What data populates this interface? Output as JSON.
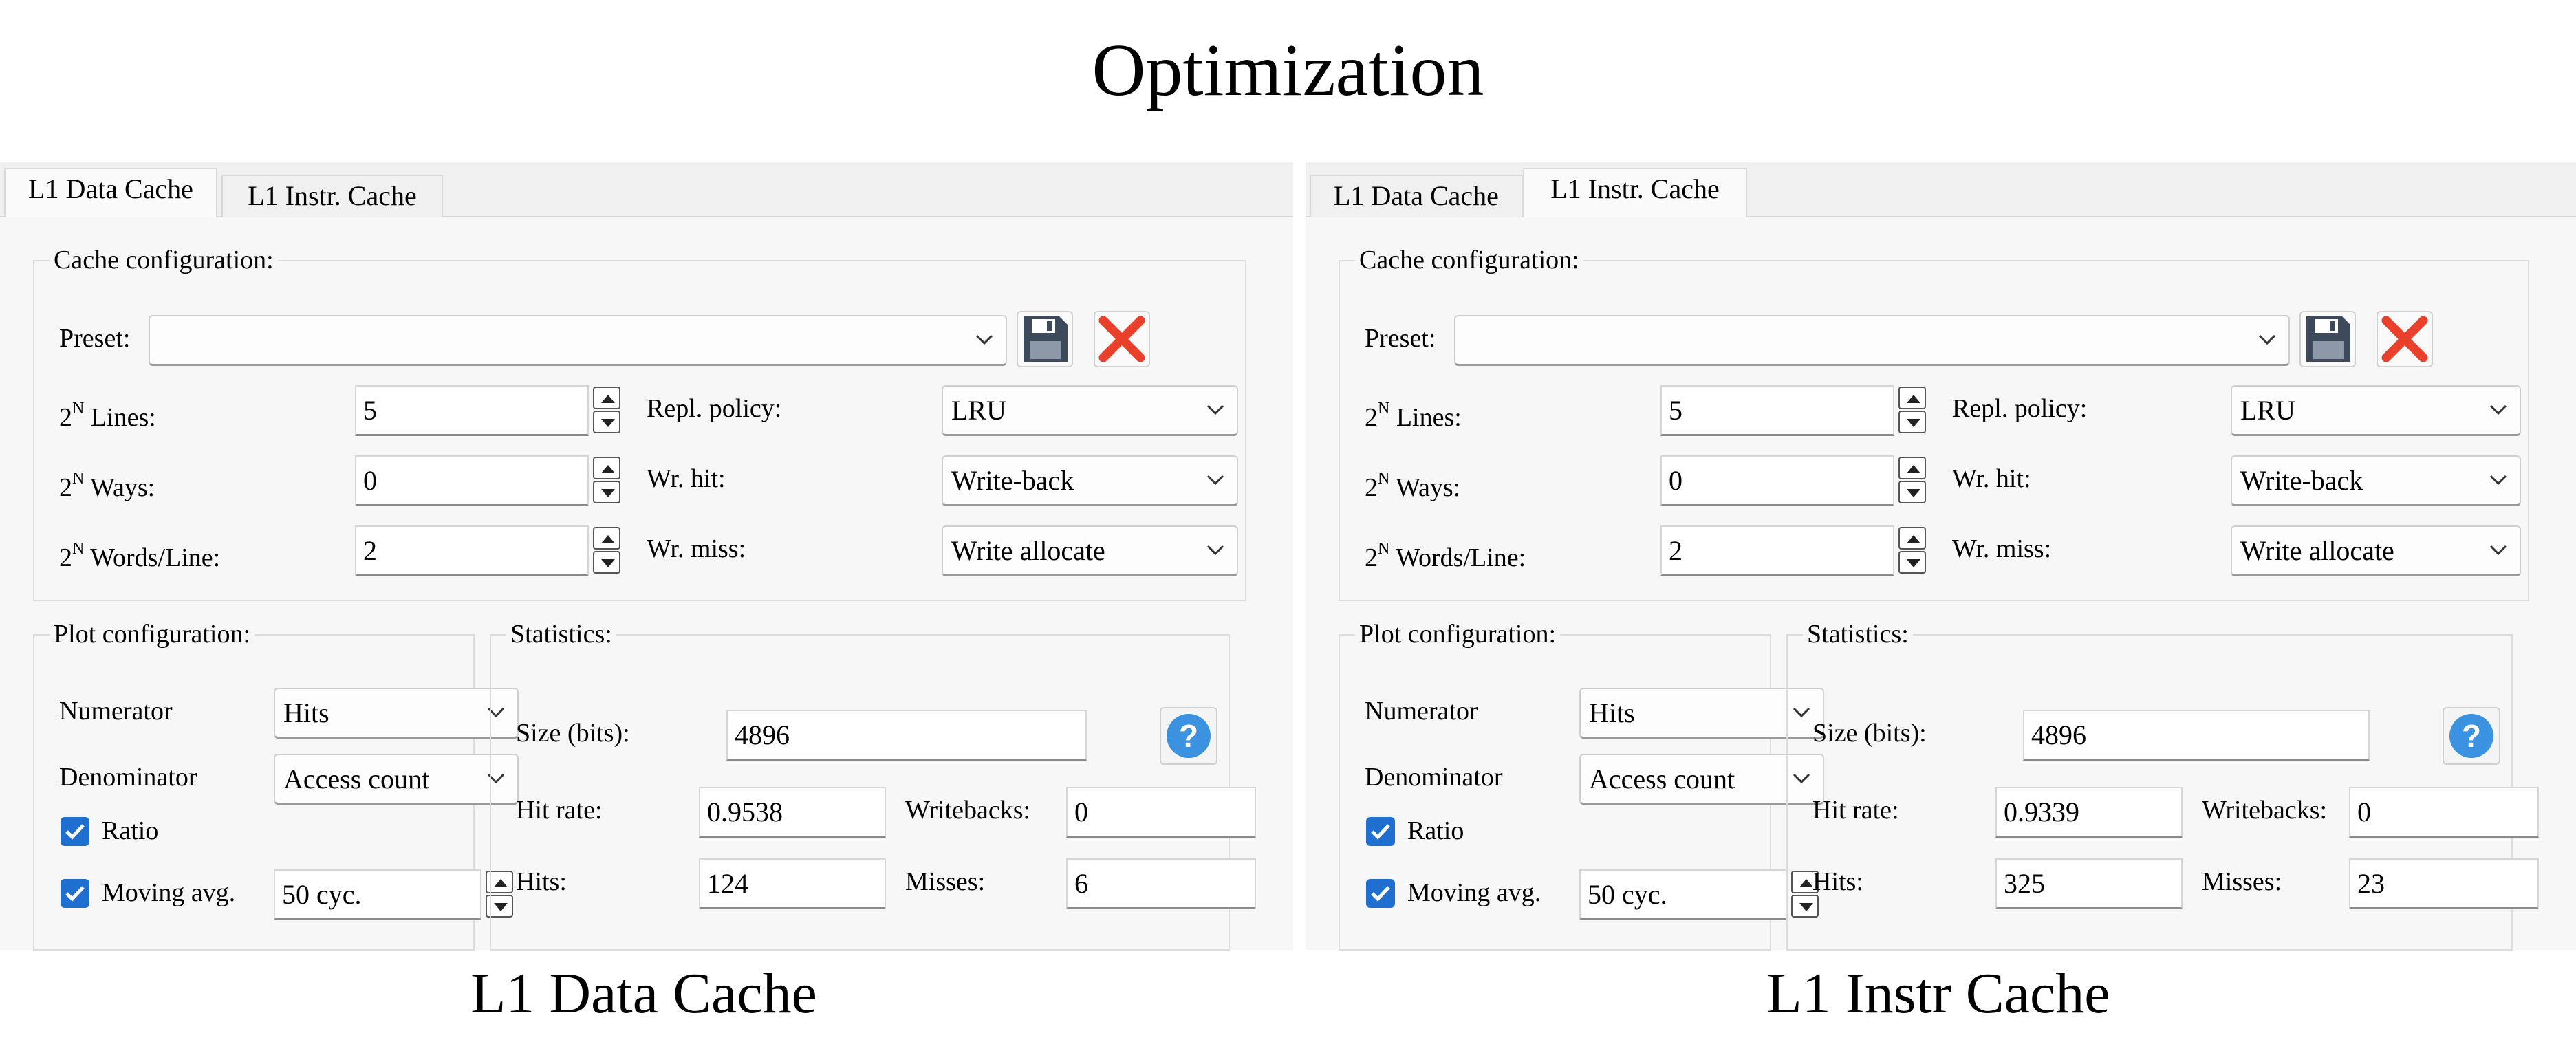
{
  "title": "Optimization",
  "tabs": [
    "L1 Data Cache",
    "L1 Instr. Cache"
  ],
  "labels": {
    "cache_config": "Cache configuration:",
    "preset": "Preset:",
    "lines": "Lines:",
    "ways": "Ways:",
    "words_line": "Words/Line:",
    "pow_base": "2",
    "pow_exp": "N",
    "repl_policy": "Repl. policy:",
    "wr_hit": "Wr. hit:",
    "wr_miss": "Wr. miss:",
    "plot_config": "Plot configuration:",
    "numerator": "Numerator",
    "denominator": "Denominator",
    "ratio": "Ratio",
    "moving_avg": "Moving avg.",
    "statistics": "Statistics:",
    "size_bits": "Size (bits):",
    "hit_rate": "Hit rate:",
    "writebacks": "Writebacks:",
    "hits": "Hits:",
    "misses": "Misses:"
  },
  "panels": [
    {
      "caption": "L1 Data Cache",
      "active_tab": 0,
      "preset": "",
      "lines": "5",
      "ways": "0",
      "words_line": "2",
      "repl_policy": "LRU",
      "wr_hit": "Write-back",
      "wr_miss": "Write allocate",
      "numerator": "Hits",
      "denominator": "Access count",
      "ratio_checked": true,
      "moving_avg_checked": true,
      "moving_avg": "50 cyc.",
      "size_bits": "4896",
      "hit_rate": "0.9538",
      "writebacks": "0",
      "hits": "124",
      "misses": "6"
    },
    {
      "caption": "L1 Instr Cache",
      "active_tab": 1,
      "preset": "",
      "lines": "5",
      "ways": "0",
      "words_line": "2",
      "repl_policy": "LRU",
      "wr_hit": "Write-back",
      "wr_miss": "Write allocate",
      "numerator": "Hits",
      "denominator": "Access count",
      "ratio_checked": true,
      "moving_avg_checked": true,
      "moving_avg": "50 cyc.",
      "size_bits": "4896",
      "hit_rate": "0.9339",
      "writebacks": "0",
      "hits": "325",
      "misses": "23"
    }
  ],
  "colors": {
    "checkbox": "#1f6fd1",
    "help": "#3a92e0",
    "delete": "#e8402a",
    "save": "#3d4a5c"
  },
  "icons": [
    "save-icon",
    "delete-icon",
    "help-icon",
    "chevron-down-icon",
    "spin-up-icon",
    "spin-down-icon",
    "checkmark-icon"
  ]
}
